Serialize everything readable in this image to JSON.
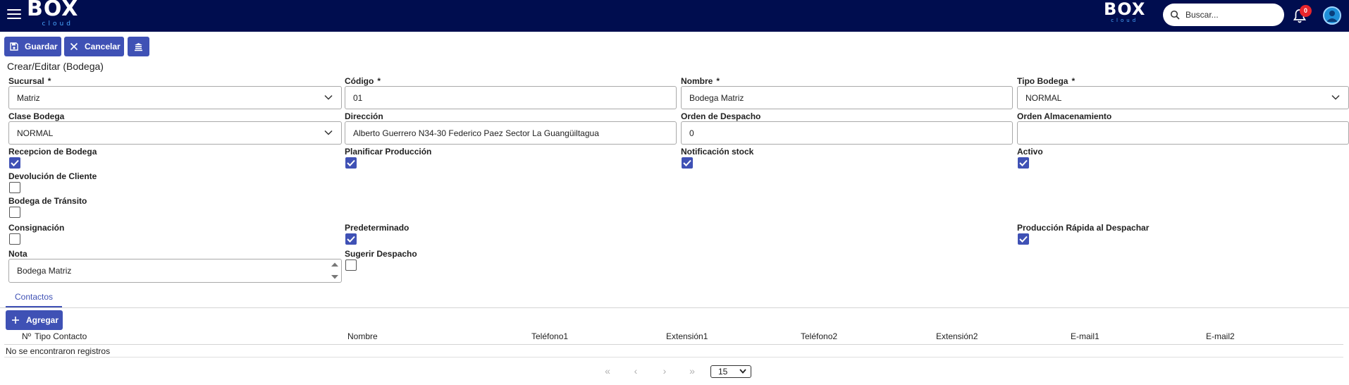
{
  "app": {
    "logo_text": "BOX",
    "logo_sub": "cloud",
    "search_placeholder": "Buscar...",
    "notification_count": "0"
  },
  "toolbar": {
    "save_label": "Guardar",
    "cancel_label": "Cancelar"
  },
  "page_title": "Crear/Editar (Bodega)",
  "form": {
    "sucursal": {
      "label": "Sucursal",
      "value": "Matriz"
    },
    "codigo": {
      "label": "Código",
      "value": "01"
    },
    "nombre": {
      "label": "Nombre",
      "value": "Bodega Matriz"
    },
    "tipo_bodega": {
      "label": "Tipo Bodega",
      "value": "NORMAL"
    },
    "clase_bodega": {
      "label": "Clase Bodega",
      "value": "NORMAL"
    },
    "direccion": {
      "label": "Dirección",
      "value": "Alberto Guerrero N34-30 Federico Paez Sector La Guangüiltagua"
    },
    "orden_despacho": {
      "label": "Orden de Despacho",
      "value": "0"
    },
    "orden_almacenamiento": {
      "label": "Orden Almacenamiento",
      "value": ""
    },
    "required_mark": "*",
    "checkboxes": {
      "recepcion_bodega": {
        "label": "Recepcion de Bodega",
        "checked": true
      },
      "planificar_produccion": {
        "label": "Planificar Producción",
        "checked": true
      },
      "notificacion_stock": {
        "label": "Notificación stock",
        "checked": true
      },
      "activo": {
        "label": "Activo",
        "checked": true
      },
      "devolucion_cliente": {
        "label": "Devolución de Cliente",
        "checked": false
      },
      "bodega_transito": {
        "label": "Bodega de Tránsito",
        "checked": false
      },
      "consignacion": {
        "label": "Consignación",
        "checked": false
      },
      "predeterminado": {
        "label": "Predeterminado",
        "checked": true
      },
      "produccion_rapida": {
        "label": "Producción Rápida al Despachar",
        "checked": true
      },
      "sugerir_despacho": {
        "label": "Sugerir Despacho",
        "checked": false
      }
    },
    "nota": {
      "label": "Nota",
      "value": "Bodega Matriz"
    }
  },
  "tabs": [
    {
      "label": "Contactos",
      "active": true
    }
  ],
  "contacts": {
    "add_label": "Agregar",
    "columns": [
      "Nº",
      "Tipo Contacto",
      "Nombre",
      "Teléfono1",
      "Extensión1",
      "Teléfono2",
      "Extensión2",
      "E-mail1",
      "E-mail2"
    ],
    "empty_message": "No se encontraron registros",
    "pager": {
      "first": "«",
      "prev": "‹",
      "next": "›",
      "last": "»",
      "page_size": "15"
    }
  }
}
